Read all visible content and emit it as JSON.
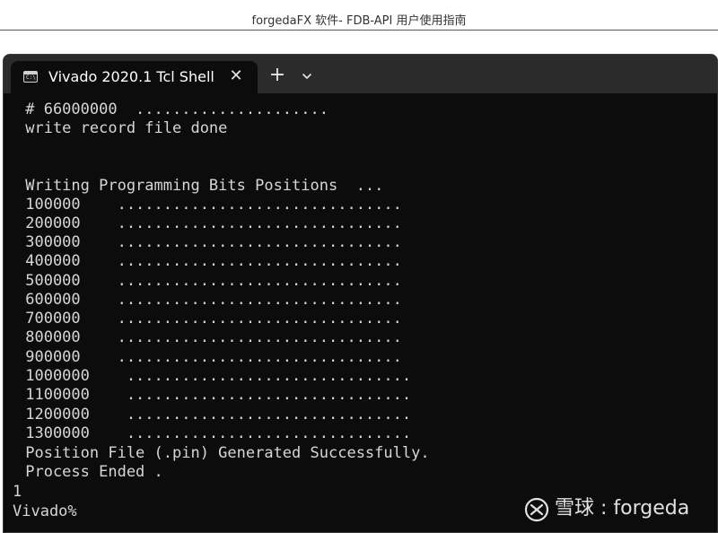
{
  "document": {
    "header_text": "forgedaFX 软件- FDB-API 用户使用指南"
  },
  "window": {
    "tab_title": "Vivado 2020.1 Tcl Shell - C",
    "tab_icon_glyph": "C:\\",
    "close_glyph": "✕",
    "new_tab_glyph": "+",
    "dropdown_icon": "chevron-down-icon"
  },
  "terminal": {
    "lines": [
      " # 66000000  .....................",
      " write record file done",
      "",
      "",
      " Writing Programming Bits Positions  ...",
      " 100000    ...............................",
      " 200000    ...............................",
      " 300000    ...............................",
      " 400000    ...............................",
      " 500000    ...............................",
      " 600000    ...............................",
      " 700000    ...............................",
      " 800000    ...............................",
      " 900000    ...............................",
      " 1000000    ...............................",
      " 1100000    ...............................",
      " 1200000    ...............................",
      " 1300000    ...............................",
      " Position File (.pin) Generated Successfully.",
      " Process Ended .",
      "1",
      "Vivado%"
    ]
  },
  "watermark": {
    "text": "雪球 : forgeda",
    "logo_icon": "snowball-logo-icon"
  },
  "colors": {
    "terminal_bg": "#0c0c0c",
    "titlebar_bg": "#2b2b2b",
    "terminal_text": "#d6d6d6"
  }
}
